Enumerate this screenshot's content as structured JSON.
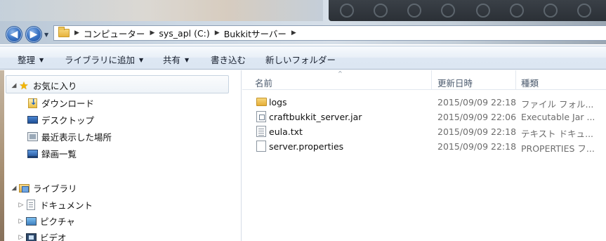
{
  "address_bar": {
    "breadcrumbs": [
      "コンピューター",
      "sys_apl (C:)",
      "Bukkitサーバー"
    ]
  },
  "command_bar": {
    "organize": "整理",
    "include_in_library": "ライブラリに追加",
    "share": "共有",
    "burn": "書き込む",
    "new_folder": "新しいフォルダー"
  },
  "nav_pane": {
    "favorites": {
      "label": "お気に入り",
      "items": [
        "ダウンロード",
        "デスクトップ",
        "最近表示した場所",
        "録画一覧"
      ]
    },
    "libraries": {
      "label": "ライブラリ",
      "items": [
        "ドキュメント",
        "ピクチャ",
        "ビデオ"
      ]
    }
  },
  "file_list": {
    "columns": [
      "名前",
      "更新日時",
      "種類"
    ],
    "rows": [
      {
        "name": "logs",
        "modified": "2015/09/09 22:18",
        "type": "ファイル フォル...",
        "icon": "folder-icon"
      },
      {
        "name": "craftbukkit_server.jar",
        "modified": "2015/09/09 22:06",
        "type": "Executable Jar ...",
        "icon": "jar-file-icon"
      },
      {
        "name": "eula.txt",
        "modified": "2015/09/09 22:18",
        "type": "テキスト ドキュ...",
        "icon": "text-file-icon"
      },
      {
        "name": "server.properties",
        "modified": "2015/09/09 22:18",
        "type": "PROPERTIES フ...",
        "icon": "file-icon"
      }
    ]
  },
  "colors": {
    "command_bar_top": "#f7fafd",
    "command_bar_bottom": "#dce6f2",
    "header_text": "#4c5b6e",
    "secondary_text": "#6d6d6d",
    "nav_button": "#3b74c4"
  }
}
